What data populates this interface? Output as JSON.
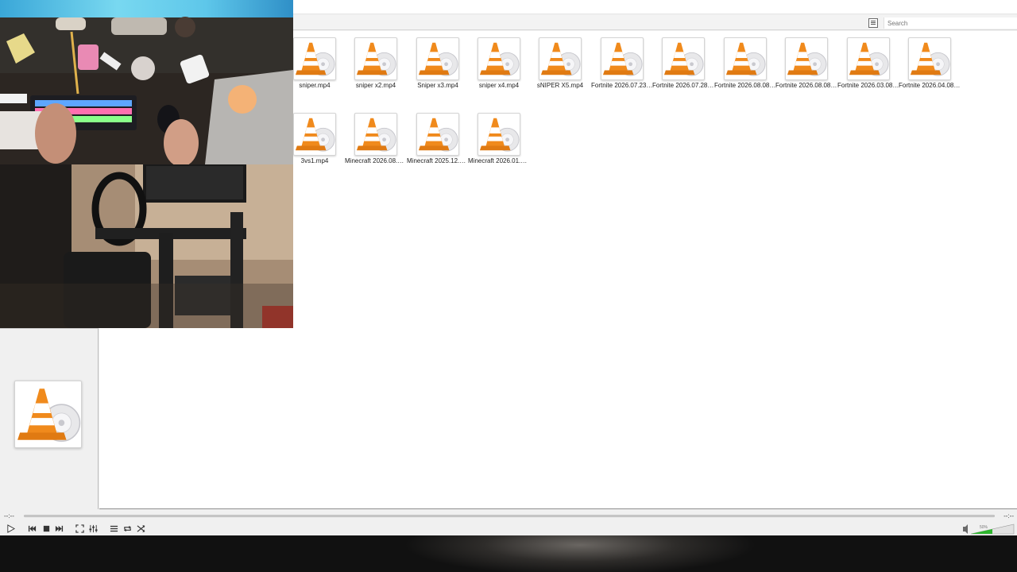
{
  "playlist": {
    "search_placeholder": "Search",
    "items": [
      {
        "label": "sniper.mp4"
      },
      {
        "label": "sniper x2.mp4"
      },
      {
        "label": "Sniper x3.mp4"
      },
      {
        "label": "sniper x4.mp4"
      },
      {
        "label": "sNIPER X5.mp4"
      },
      {
        "label": "Fortnite 2026.07.23 -..."
      },
      {
        "label": "Fortnite 2026.07.28 -..."
      },
      {
        "label": "Fortnite 2026.08.08 -..."
      },
      {
        "label": "Fortnite 2026.08.08 -..."
      },
      {
        "label": "Fortnite 2026.03.08 -..."
      },
      {
        "label": "Fortnite 2026.04.08 -..."
      },
      {
        "label": "3vs1.mp4"
      },
      {
        "label": "Minecraft 2026.08.09..."
      },
      {
        "label": "Minecraft 2025.12.06..."
      },
      {
        "label": "Minecraft 2026.01.26..."
      }
    ]
  },
  "player": {
    "elapsed": "--:--",
    "remaining": "--:--",
    "volume_label": "50%",
    "volume": 0.5
  },
  "colors": {
    "vlc_orange": "#f08a1c",
    "volume_green": "#2db52d"
  }
}
